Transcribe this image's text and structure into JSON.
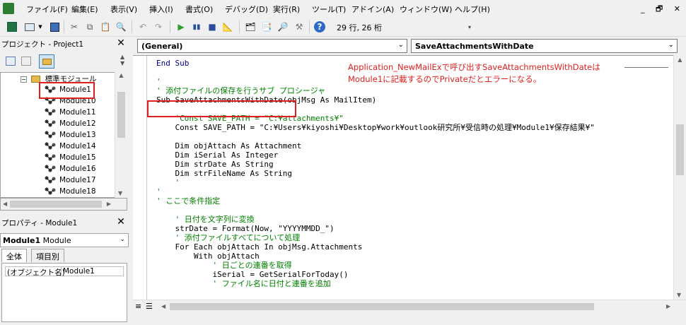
{
  "menu": [
    "ファイル(F)",
    "編集(E)",
    "表示(V)",
    "挿入(I)",
    "書式(O)",
    "デバッグ(D)",
    "実行(R)",
    "ツール(T)",
    "アドイン(A)",
    "ウィンドウ(W)",
    "ヘルプ(H)"
  ],
  "window_controls": {
    "minimize": "_",
    "restore": "🗗",
    "close": "✕"
  },
  "toolbar": {
    "position_label": "29 行, 26 桁",
    "icons": [
      "excel-icon",
      "insert-userform-icon",
      "save-icon",
      "cut-icon",
      "copy-icon",
      "paste-icon",
      "find-icon",
      "undo-icon",
      "redo-icon",
      "run-icon",
      "break-icon",
      "reset-icon",
      "design-mode-icon",
      "project-explorer-icon",
      "properties-icon",
      "object-browser-icon",
      "toolbox-icon",
      "help-icon"
    ]
  },
  "project_pane": {
    "title": "プロジェクト - Project1",
    "close_label": "✕",
    "folder_label": "標準モジュール",
    "modules": [
      "Module1",
      "Module10",
      "Module11",
      "Module12",
      "Module13",
      "Module14",
      "Module15",
      "Module16",
      "Module17",
      "Module18"
    ]
  },
  "properties_pane": {
    "title": "プロパティ - Module1",
    "close_label": "✕",
    "combo_name": "Module1",
    "combo_type": "Module",
    "tabs": [
      "全体",
      "項目別"
    ],
    "prop_name": "(オブジェクト名)",
    "prop_value": "Module1"
  },
  "code_window": {
    "object_combo": "(General)",
    "proc_combo": "SaveAttachmentsWithDate"
  },
  "annotation": {
    "line1": "Application_NewMailExで呼び出すSaveAttachmentsWithDateは",
    "line2": "Module1に記載するのでPrivateだとエラーになる。"
  },
  "code_lines": [
    {
      "text": "End Sub",
      "cls": "kw"
    },
    {
      "text": "",
      "cls": ""
    },
    {
      "text": "'",
      "cls": "cmt"
    },
    {
      "text": "' 添付ファイルの保存を行うサブ プロシージャ",
      "cls": "cmt"
    },
    {
      "text": "Sub SaveAttachmentsWithDate(objMsg As MailItem)",
      "cls": ""
    },
    {
      "text": "",
      "cls": ""
    },
    {
      "text": "    'Const SAVE_PATH = \"C:¥attachments¥\"",
      "cls": "cmt"
    },
    {
      "text": "    Const SAVE_PATH = \"C:¥Users¥kiyoshi¥Desktop¥work¥outlook研究所¥受信時の処理¥Module1¥保存結果¥\"",
      "cls": ""
    },
    {
      "text": "",
      "cls": ""
    },
    {
      "text": "    Dim objAttach As Attachment",
      "cls": ""
    },
    {
      "text": "    Dim iSerial As Integer",
      "cls": ""
    },
    {
      "text": "    Dim strDate As String",
      "cls": ""
    },
    {
      "text": "    Dim strFileName As String",
      "cls": ""
    },
    {
      "text": "    '",
      "cls": "cmt"
    },
    {
      "text": "'",
      "cls": "cmt"
    },
    {
      "text": "' ここで条件指定",
      "cls": "cmt"
    },
    {
      "text": "",
      "cls": ""
    },
    {
      "text": "    ' 日付を文字列に変換",
      "cls": "cmt"
    },
    {
      "text": "    strDate = Format(Now, \"YYYYMMDD_\")",
      "cls": ""
    },
    {
      "text": "    ' 添付ファイルすべてについて処理",
      "cls": "cmt"
    },
    {
      "text": "    For Each objAttach In objMsg.Attachments",
      "cls": ""
    },
    {
      "text": "        With objAttach",
      "cls": ""
    },
    {
      "text": "            ' 日ごとの連番を取得",
      "cls": "cmt"
    },
    {
      "text": "            iSerial = GetSerialForToday()",
      "cls": ""
    },
    {
      "text": "            ' ファイル名に日付と連番を追加",
      "cls": "cmt"
    }
  ]
}
